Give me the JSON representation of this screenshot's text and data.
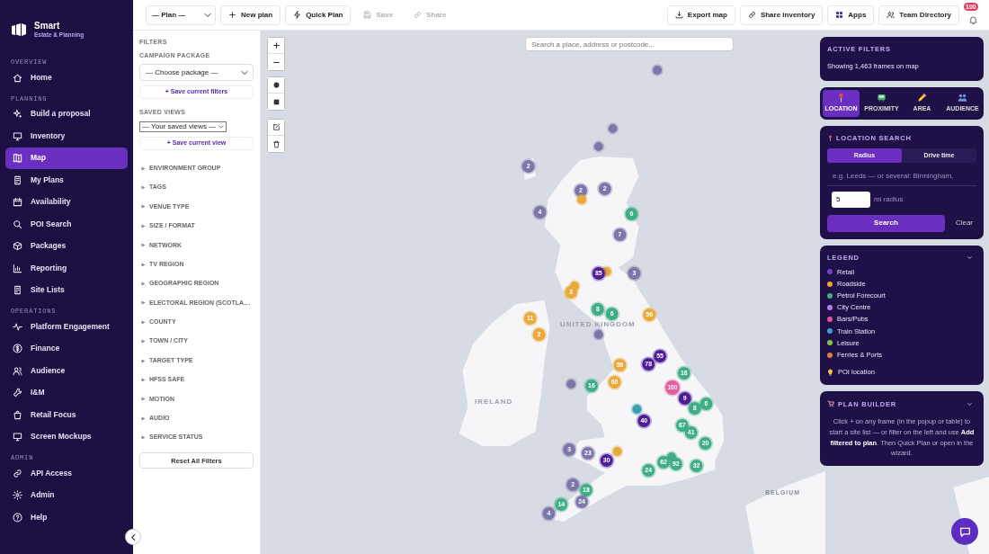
{
  "brand": {
    "name": "Smart",
    "tagline": "Estate & Planning"
  },
  "sidebar": {
    "sections": [
      {
        "heading": "OVERVIEW",
        "items": [
          {
            "label": "Home",
            "selected": false
          }
        ]
      },
      {
        "heading": "PLANNING",
        "items": [
          {
            "label": "Build a proposal",
            "selected": false
          },
          {
            "label": "Inventory",
            "selected": false
          },
          {
            "label": "Map",
            "selected": true
          },
          {
            "label": "My Plans",
            "selected": false
          },
          {
            "label": "Availability",
            "selected": false
          },
          {
            "label": "POI Search",
            "selected": false
          },
          {
            "label": "Packages",
            "selected": false
          },
          {
            "label": "Reporting",
            "selected": false
          },
          {
            "label": "Site Lists",
            "selected": false
          }
        ]
      },
      {
        "heading": "OPERATIONS",
        "items": [
          {
            "label": "Platform Engagement",
            "selected": false
          },
          {
            "label": "Finance",
            "selected": false
          },
          {
            "label": "Audience",
            "selected": false
          },
          {
            "label": "I&M",
            "selected": false
          },
          {
            "label": "Retail Focus",
            "selected": false
          },
          {
            "label": "Screen Mockups",
            "selected": false
          }
        ]
      },
      {
        "heading": "ADMIN",
        "items": [
          {
            "label": "API Access",
            "selected": false
          },
          {
            "label": "Admin",
            "selected": false
          },
          {
            "label": "Help",
            "selected": false
          }
        ]
      }
    ]
  },
  "toolbar": {
    "plan_select": "— Plan —",
    "left_buttons": [
      {
        "label": "New plan",
        "disabled": false
      },
      {
        "label": "Quick Plan",
        "disabled": false
      },
      {
        "label": "Save",
        "disabled": true
      },
      {
        "label": "Share",
        "disabled": true
      }
    ],
    "right_buttons": [
      {
        "label": "Export map",
        "disabled": false
      },
      {
        "label": "Share inventory",
        "disabled": false
      },
      {
        "label": "Apps",
        "disabled": false
      },
      {
        "label": "Team Directory",
        "disabled": false
      }
    ],
    "notification_count": "100"
  },
  "filters": {
    "heading": "FILTERS",
    "package_label": "CAMPAIGN PACKAGE",
    "package_select": "— Choose package —",
    "save_filters": "+ Save current filters",
    "views_label": "SAVED VIEWS",
    "views_select": "— Your saved views —",
    "save_view": "+ Save current view",
    "groups": [
      {
        "label": "ENVIRONMENT GROUP",
        "expanded": false
      },
      {
        "label": "TAGS",
        "expanded": false
      },
      {
        "label": "VENUE TYPE",
        "expanded": false
      },
      {
        "label": "SIZE / FORMAT",
        "expanded": false
      },
      {
        "label": "NETWORK",
        "expanded": false
      },
      {
        "label": "TV REGION",
        "expanded": false
      },
      {
        "label": "GEOGRAPHIC REGION",
        "expanded": false
      },
      {
        "label": "ELECTORAL REGION (SCOTLA…",
        "expanded": false
      },
      {
        "label": "COUNTY",
        "expanded": false
      },
      {
        "label": "TOWN / CITY",
        "expanded": false
      },
      {
        "label": "TARGET TYPE",
        "expanded": false
      },
      {
        "label": "HFSS SAFE",
        "expanded": false
      },
      {
        "label": "MOTION",
        "expanded": false
      },
      {
        "label": "AUDIO",
        "expanded": false
      },
      {
        "label": "SERVICE STATUS",
        "expanded": false
      }
    ],
    "reset": "Reset All Filters"
  },
  "map": {
    "search_placeholder": "Search a place, address or postcode...",
    "place_labels": [
      "UNITED KINGDOM",
      "IRELAND",
      "BELGIUM"
    ],
    "markers": [
      {
        "color": "#7d76a9"
      },
      {
        "color": "#7d76a9"
      },
      {
        "color": "#7d76a9"
      },
      {
        "label": "2",
        "color": "#7d76a9"
      },
      {
        "label": "2",
        "color": "#7d76a9"
      },
      {
        "color": "#e9a93b"
      },
      {
        "label": "2",
        "color": "#7d76a9"
      },
      {
        "label": "4",
        "color": "#7d76a9"
      },
      {
        "label": "6",
        "color": "#3fae86"
      },
      {
        "label": "7",
        "color": "#7d76a9"
      },
      {
        "color": "#e9a93b"
      },
      {
        "label": "85",
        "color": "#4c1d95"
      },
      {
        "label": "3",
        "color": "#7d76a9"
      },
      {
        "color": "#e9a93b"
      },
      {
        "label": "3",
        "color": "#e9a93b"
      },
      {
        "label": "8",
        "color": "#3fae86"
      },
      {
        "label": "6",
        "color": "#3fae86"
      },
      {
        "label": "56",
        "color": "#e9a93b"
      },
      {
        "label": "11",
        "color": "#e9a93b"
      },
      {
        "label": "2",
        "color": "#e9a93b"
      },
      {
        "color": "#7d76a9"
      },
      {
        "label": "55",
        "color": "#4c1d95"
      },
      {
        "label": "78",
        "color": "#4c1d95"
      },
      {
        "label": "56",
        "color": "#e9a93b"
      },
      {
        "label": "16",
        "color": "#3fae86"
      },
      {
        "color": "#7d76a9"
      },
      {
        "label": "16",
        "color": "#3fae86"
      },
      {
        "label": "60",
        "color": "#e9a93b"
      },
      {
        "label": "100",
        "color": "#e2609e"
      },
      {
        "label": "9",
        "color": "#4c1d95"
      },
      {
        "label": "6",
        "color": "#3fae86"
      },
      {
        "label": "8",
        "color": "#3fae86"
      },
      {
        "color": "#3a9fb0"
      },
      {
        "label": "40",
        "color": "#4c1d95"
      },
      {
        "label": "67",
        "color": "#3fae86"
      },
      {
        "label": "41",
        "color": "#3fae86"
      },
      {
        "label": "20",
        "color": "#3fae86"
      },
      {
        "label": "3",
        "color": "#7d76a9"
      },
      {
        "label": "23",
        "color": "#7d76a9"
      },
      {
        "color": "#e9a93b"
      },
      {
        "label": "30",
        "color": "#4c1d95"
      },
      {
        "color": "#3fae86"
      },
      {
        "label": "62",
        "color": "#3fae86"
      },
      {
        "label": "92",
        "color": "#3fae86"
      },
      {
        "label": "32",
        "color": "#3fae86"
      },
      {
        "label": "24",
        "color": "#3fae86"
      },
      {
        "label": "2",
        "color": "#7d76a9"
      },
      {
        "label": "18",
        "color": "#3fae86"
      },
      {
        "label": "24",
        "color": "#7d76a9"
      },
      {
        "label": "14",
        "color": "#3fae86"
      },
      {
        "label": "4",
        "color": "#7d76a9"
      }
    ]
  },
  "active_filters": {
    "heading": "ACTIVE FILTERS",
    "summary": "Showing 1,463 frames on map"
  },
  "mode_tabs": [
    {
      "label": "LOCATION",
      "selected": true
    },
    {
      "label": "PROXIMITY",
      "selected": false
    },
    {
      "label": "AREA",
      "selected": false
    },
    {
      "label": "AUDIENCE",
      "selected": false
    }
  ],
  "location_search": {
    "heading": "LOCATION SEARCH",
    "modes": [
      {
        "label": "Radius",
        "selected": true
      },
      {
        "label": "Drive time",
        "selected": false
      }
    ],
    "placeholder": "e.g. Leeds — or several: Birmingham,",
    "radius_value": "5",
    "radius_unit": "mi radius",
    "search_button": "Search",
    "clear_button": "Clear"
  },
  "legend": {
    "heading": "LEGEND",
    "expanded": true,
    "items": [
      {
        "label": "Retail",
        "color": "#7043c4"
      },
      {
        "label": "Roadside",
        "color": "#eca23a"
      },
      {
        "label": "Petrol Forecourt",
        "color": "#3fae86"
      },
      {
        "label": "City Centre",
        "color": "#b57ee8"
      },
      {
        "label": "Bars/Pubs",
        "color": "#d9559b"
      },
      {
        "label": "Train Station",
        "color": "#3d9fcf"
      },
      {
        "label": "Leisure",
        "color": "#7fc447"
      },
      {
        "label": "Ferries & Ports",
        "color": "#e0803e"
      }
    ],
    "poi_label": "POI location"
  },
  "plan_builder": {
    "heading": "PLAN BUILDER",
    "expanded": true,
    "text": "Click + on any frame (in the popup or table) to start a site list — or filter on the left and use **Add filtered to plan**. Then Quick Plan or open in the wizard."
  }
}
